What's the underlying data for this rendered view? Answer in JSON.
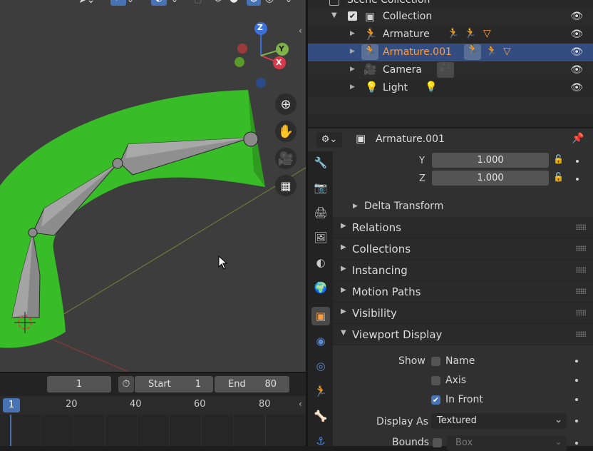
{
  "outliner": {
    "scene_collection": "Scene Collection",
    "collection": "Collection",
    "items": [
      {
        "label": "Armature",
        "color": "#dcdcdc"
      },
      {
        "label": "Armature.001",
        "color": "#ff9f3f"
      },
      {
        "label": "Camera",
        "color": "#dcdcdc"
      },
      {
        "label": "Light",
        "color": "#dcdcdc"
      }
    ]
  },
  "properties": {
    "object_name": "Armature.001",
    "scale": {
      "y_label": "Y",
      "y_value": "1.000",
      "z_label": "Z",
      "z_value": "1.000"
    },
    "delta_transform": "Delta Transform",
    "panels": [
      "Relations",
      "Collections",
      "Instancing",
      "Motion Paths",
      "Visibility",
      "Viewport Display"
    ],
    "viewport_display": {
      "show_label": "Show",
      "name_label": "Name",
      "axis_label": "Axis",
      "in_front_label": "In Front",
      "display_as_label": "Display As",
      "display_as_value": "Textured",
      "bounds_label": "Bounds",
      "bounds_value": "Box",
      "in_front_checked": true
    }
  },
  "timeline": {
    "current_frame": "1",
    "start_label": "Start",
    "start_value": "1",
    "end_label": "End",
    "end_value": "80",
    "ruler": [
      "1",
      "20",
      "40",
      "60",
      "80"
    ]
  },
  "viewport": {
    "gizmo": {
      "z": "Z",
      "y": "Y",
      "x": "X"
    }
  },
  "colors": {
    "accent": "#4772b3",
    "selected_row": "#334d80",
    "active_object": "#ff9f3f",
    "armature_icon": "#3fbf9f",
    "mesh_green": "#38bd28"
  }
}
